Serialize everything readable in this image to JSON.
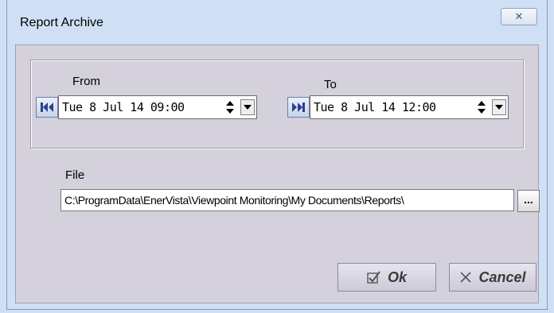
{
  "window": {
    "title": "Report Archive",
    "close_symbol": "✕"
  },
  "range": {
    "from_label": "From",
    "to_label": "To",
    "from_value": "Tue  8  Jul 14 09:00",
    "to_value": "Tue  8  Jul 14 12:00"
  },
  "file": {
    "label": "File",
    "path": "C:\\ProgramData\\EnerVista\\Viewpoint Monitoring\\My Documents\\Reports\\",
    "browse_label": "..."
  },
  "buttons": {
    "ok": "Ok",
    "cancel": "Cancel"
  },
  "icons": {
    "first": "skip-to-start-icon",
    "last": "skip-to-end-icon",
    "ok": "checkbox-check-icon",
    "cancel": "x-icon",
    "accent": "#2d3f8f"
  }
}
